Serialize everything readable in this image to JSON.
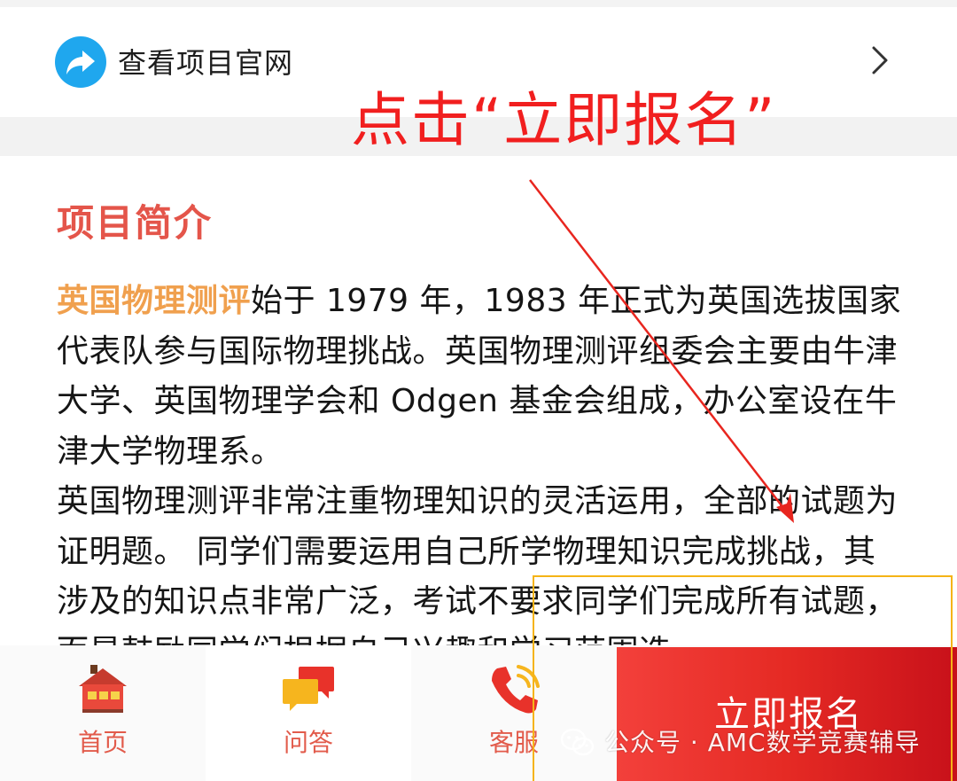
{
  "site_link": {
    "label": "查看项目官网"
  },
  "annotation": {
    "text": "点击“立即报名”"
  },
  "section": {
    "title": "项目简介"
  },
  "intro": {
    "highlight": "英国物理测评",
    "para1_rest": "始于 1979 年，1983 年正式为英国选拔国家代表队参与国际物理挑战。英国物理测评组委会主要由牛津大学、英国物理学会和 Odgen 基金会组成，办公室设在牛津大学物理系。",
    "para2": "英国物理测评非常注重物理知识的灵活运用，全部的试题为证明题。 同学们需要运用自己所学物理知识完成挑战，其涉及的知识点非常广泛，考试不要求同学们完成所有试题，而是鼓励同学们根据自己兴趣和学习范围选"
  },
  "bottom_nav": {
    "tabs": [
      {
        "label": "首页",
        "icon": "home-icon"
      },
      {
        "label": "问答",
        "icon": "chat-bubbles-icon"
      },
      {
        "label": "客服",
        "icon": "phone-icon"
      }
    ],
    "signup_label": "立即报名"
  },
  "watermark": {
    "text": "公众号 · AMC数学竞赛辅导"
  },
  "colors": {
    "annotation_red": "#f11f1f",
    "title_red": "#e4554a",
    "highlight_orange": "#f0a04e",
    "link_blue": "#1fa7ee",
    "button_red": "#e52a24",
    "box_yellow": "#f5b417"
  }
}
